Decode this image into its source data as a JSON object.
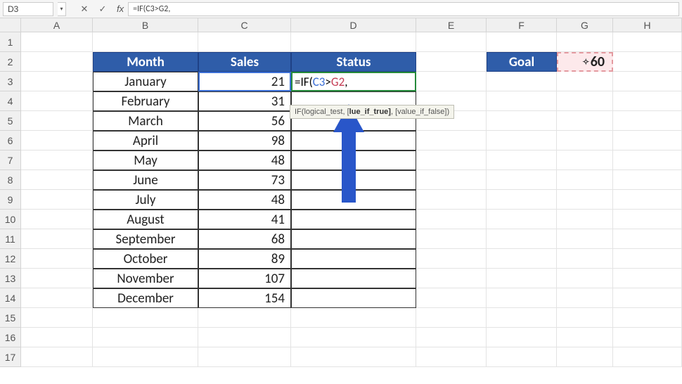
{
  "toolbar": {
    "namebox": "D3",
    "cancel_icon": "✕",
    "confirm_icon": "✓",
    "fx_label": "fx",
    "formula": "=IF(C3>G2,"
  },
  "columns": [
    "A",
    "B",
    "C",
    "D",
    "E",
    "F",
    "G",
    "H"
  ],
  "row_nums": [
    1,
    2,
    3,
    4,
    5,
    6,
    7,
    8,
    9,
    10,
    11,
    12,
    13,
    14,
    15,
    16,
    17
  ],
  "headers": {
    "month": "Month",
    "sales": "Sales",
    "status": "Status",
    "goal": "Goal"
  },
  "goal_value": "60",
  "rows": [
    {
      "month": "January",
      "sales": "21"
    },
    {
      "month": "February",
      "sales": "31"
    },
    {
      "month": "March",
      "sales": "56"
    },
    {
      "month": "April",
      "sales": "98"
    },
    {
      "month": "May",
      "sales": "48"
    },
    {
      "month": "June",
      "sales": "73"
    },
    {
      "month": "July",
      "sales": "48"
    },
    {
      "month": "August",
      "sales": "41"
    },
    {
      "month": "September",
      "sales": "68"
    },
    {
      "month": "October",
      "sales": "89"
    },
    {
      "month": "November",
      "sales": "107"
    },
    {
      "month": "December",
      "sales": "154"
    }
  ],
  "editing": {
    "eq": "=",
    "fn": "IF(",
    "ref1": "C3",
    "gt": ">",
    "ref2": "G2",
    "tail": ","
  },
  "tooltip": {
    "fn": "IF(",
    "a1": "logical_test",
    "sep1": ", [",
    "a2_suffix": "lue_if_true]",
    "sep2": ", [value_if_false])"
  }
}
